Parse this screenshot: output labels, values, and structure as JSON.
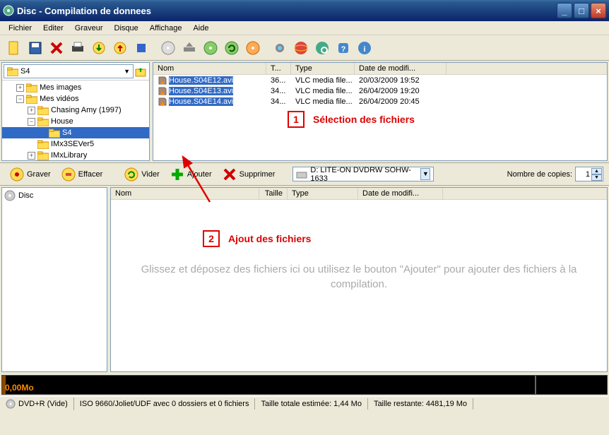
{
  "window": {
    "title": "Disc - Compilation de donnees"
  },
  "menu": {
    "fichier": "Fichier",
    "editer": "Editer",
    "graveur": "Graveur",
    "disque": "Disque",
    "affichage": "Affichage",
    "aide": "Aide"
  },
  "pathbox": {
    "label": "S4"
  },
  "tree": {
    "items": [
      {
        "label": "Mes images",
        "indent": 1,
        "exp": "+",
        "selected": false
      },
      {
        "label": "Mes vidéos",
        "indent": 1,
        "exp": "−",
        "selected": false
      },
      {
        "label": "Chasing Amy (1997)",
        "indent": 2,
        "exp": "+",
        "selected": false
      },
      {
        "label": "House",
        "indent": 2,
        "exp": "−",
        "selected": false
      },
      {
        "label": "S4",
        "indent": 3,
        "exp": "",
        "selected": true
      },
      {
        "label": "IMx3SEVer5",
        "indent": 2,
        "exp": "",
        "selected": false
      },
      {
        "label": "IMxLibrary",
        "indent": 2,
        "exp": "+",
        "selected": false
      }
    ]
  },
  "filecols": {
    "nom": "Nom",
    "taille": "T...",
    "type": "Type",
    "date": "Date de modifi..."
  },
  "files": [
    {
      "name": "House.S04E12.avi",
      "size": "36...",
      "type": "VLC media file...",
      "date": "20/03/2009 19:52"
    },
    {
      "name": "House.S04E13.avi",
      "size": "34...",
      "type": "VLC media file...",
      "date": "26/04/2009 19:20"
    },
    {
      "name": "House.S04E14.avi",
      "size": "34...",
      "type": "VLC media file...",
      "date": "26/04/2009 20:45"
    }
  ],
  "callout1": {
    "num": "1",
    "text": "Sélection des fichiers"
  },
  "actions": {
    "graver": "Graver",
    "effacer": "Effacer",
    "vider": "Vider",
    "ajouter": "Ajouter",
    "supprimer": "Supprimer",
    "copies_label": "Nombre de copies:",
    "copies": "1"
  },
  "drive": {
    "label": "D: LITE-ON DVDRW SOHW-1633"
  },
  "comp": {
    "disc": "Disc"
  },
  "compcols": {
    "nom": "Nom",
    "taille": "Taille",
    "type": "Type",
    "date": "Date de modifi..."
  },
  "placeholder": "Glissez et déposez des fichiers ici ou utilisez le bouton \"Ajouter\" pour ajouter des fichiers à la compilation.",
  "callout2": {
    "num": "2",
    "text": "Ajout des fichiers"
  },
  "progress": {
    "text": "0,00Mo"
  },
  "status": {
    "media": "DVD+R (Vide)",
    "fs": "ISO 9660/Joliet/UDF avec 0 dossiers et 0 fichiers",
    "total": "Taille totale estimée: 1,44 Mo",
    "rest": "Taille restante: 4481,19 Mo"
  }
}
